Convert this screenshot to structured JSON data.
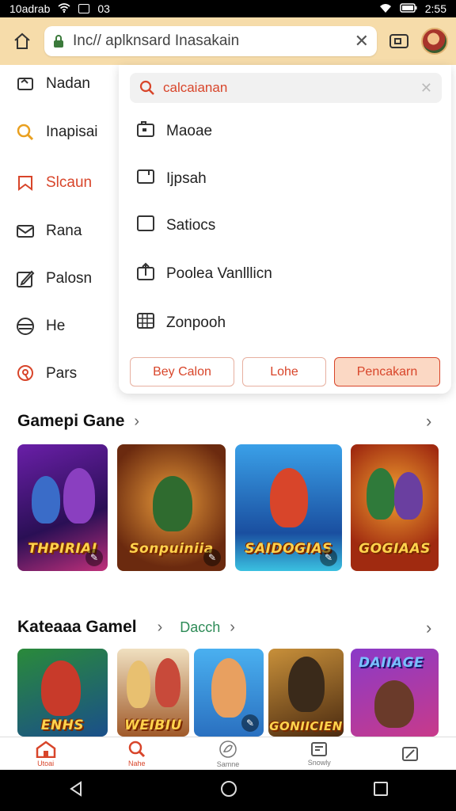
{
  "status_bar": {
    "left_text": "10adrab",
    "left_num": "03",
    "time": "2:55"
  },
  "app_bar": {
    "url": "Inc// aplknsard Inasakain"
  },
  "sidebar": {
    "items": [
      {
        "label": "Nadan",
        "icon": "image-icon"
      },
      {
        "label": "Inapisai",
        "icon": "search-icon"
      },
      {
        "label": "Slcaun",
        "icon": "bookmark-icon",
        "active": true
      },
      {
        "label": "Rana",
        "icon": "mail-icon"
      },
      {
        "label": "Palosn",
        "icon": "edit-icon"
      },
      {
        "label": "He",
        "icon": "globe-icon"
      },
      {
        "label": "Pars",
        "icon": "location-icon"
      }
    ]
  },
  "popup": {
    "search_placeholder": "calcaianan",
    "items": [
      {
        "label": "Maoae",
        "icon": "folder-icon"
      },
      {
        "label": "Ijpsah",
        "icon": "window-icon"
      },
      {
        "label": "Satiocs",
        "icon": "square-icon"
      },
      {
        "label": "Poolea Vanlllicn",
        "icon": "upload-icon"
      },
      {
        "label": "Zonpooh",
        "icon": "grid-icon"
      }
    ],
    "buttons": {
      "first": "Bey Calon",
      "second": "Lohe",
      "third": "Pencakarn"
    }
  },
  "section1": {
    "title": "Gamepi Gane",
    "tiles": [
      "THPIRIAI",
      "Sonpuiniia",
      "SAIDOGIAS",
      "GOGIAAS"
    ]
  },
  "section2": {
    "title": "Kateaaa Gamel",
    "link": "Dacch",
    "tiles": [
      "ENHS",
      "WEIBIU",
      "",
      "GONIICIEN",
      "DAIIAGE"
    ]
  },
  "bottom_nav": {
    "items": [
      {
        "label": "Utoai",
        "icon": "home-icon"
      },
      {
        "label": "Nahe",
        "icon": "search-icon"
      },
      {
        "label": "Samne",
        "icon": "leaf-icon"
      },
      {
        "label": "Snowly",
        "icon": "news-icon"
      },
      {
        "label": "",
        "icon": "edit-icon"
      }
    ]
  },
  "colors": {
    "accent": "#d8452a",
    "appbar": "#f6dcaa",
    "link": "#2e8b57"
  }
}
